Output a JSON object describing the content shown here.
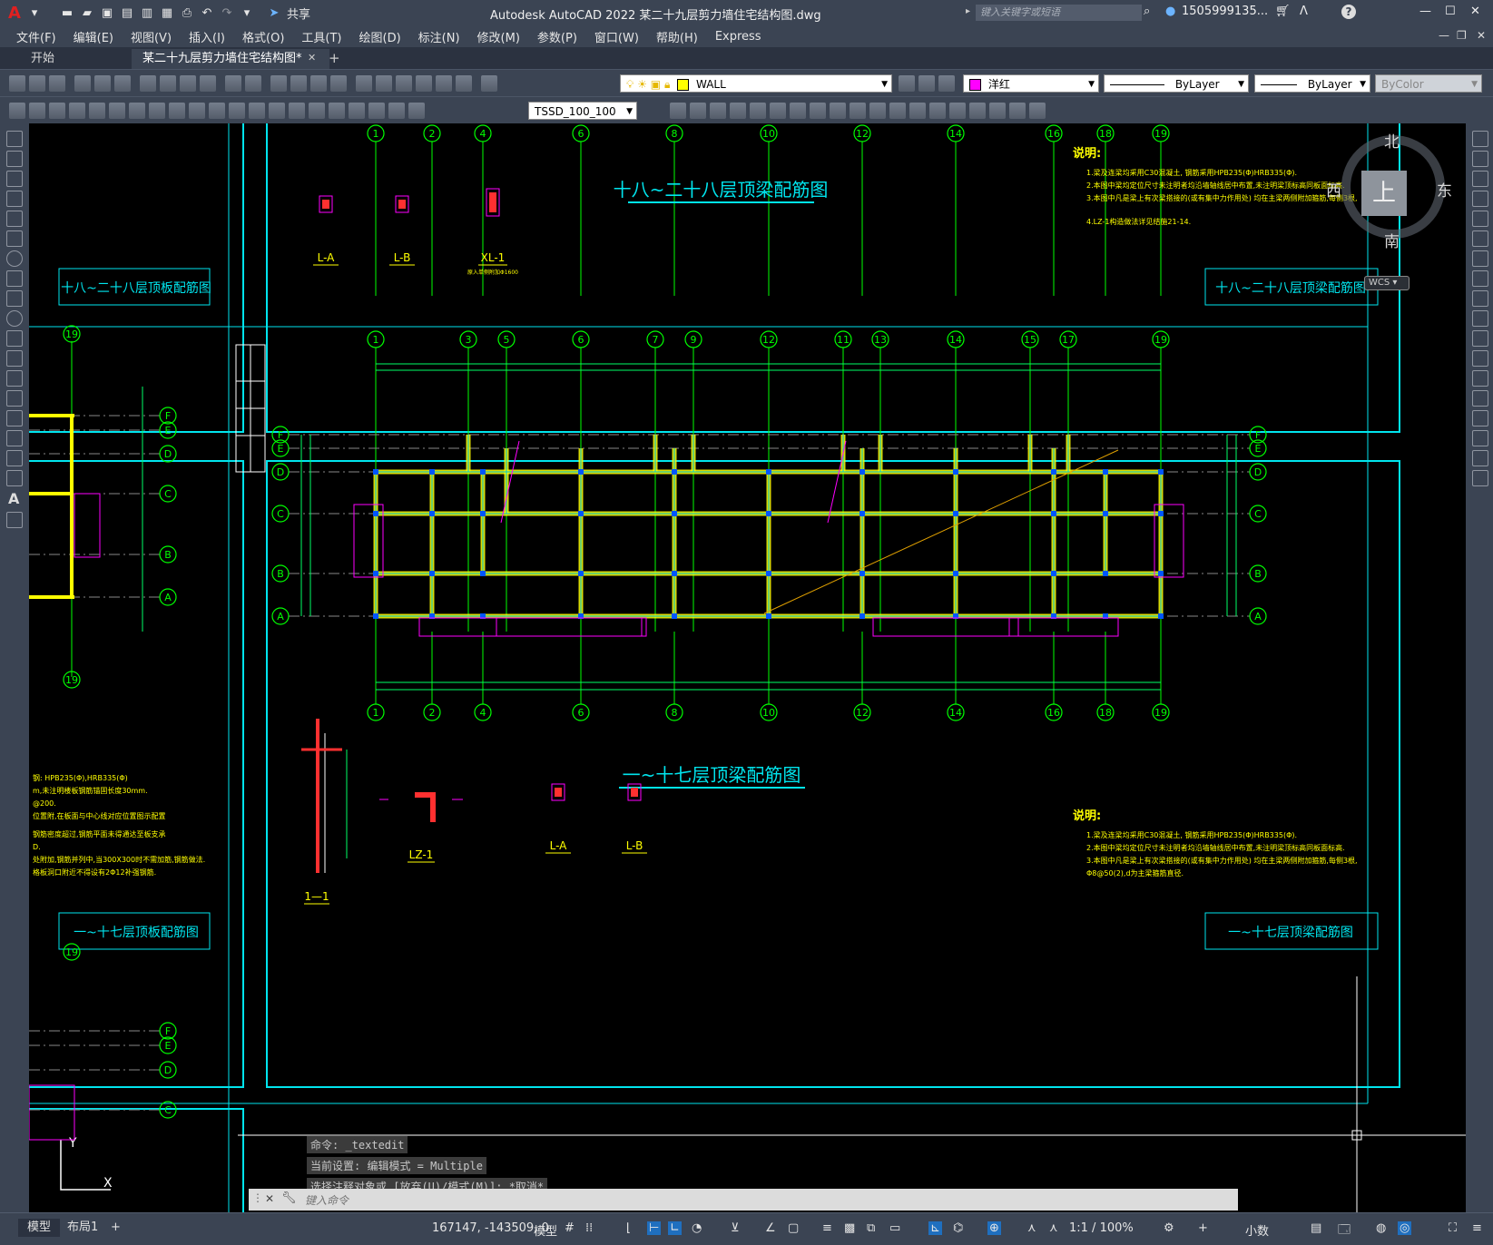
{
  "app": {
    "title": "Autodesk AutoCAD 2022    某二十九层剪力墙住宅结构图.dwg",
    "share_label": "共享",
    "search_placeholder": "键入关键字或短语",
    "user": "1505999135...",
    "logo_letter": "A"
  },
  "menu": [
    "文件(F)",
    "编辑(E)",
    "视图(V)",
    "插入(I)",
    "格式(O)",
    "工具(T)",
    "绘图(D)",
    "标注(N)",
    "修改(M)",
    "参数(P)",
    "窗口(W)",
    "帮助(H)",
    "Express"
  ],
  "tabs": [
    {
      "label": "开始"
    },
    {
      "label": "某二十九层剪力墙住宅结构图*"
    }
  ],
  "toolbar": {
    "layer": "WALL",
    "color": "洋红",
    "linetype": "ByLayer",
    "lineweight": "ByLayer",
    "plotstyle": "ByColor",
    "textstyle": "TSSD_100_100"
  },
  "colors": {
    "frame": "#00e5ee",
    "axis": "#00ff00",
    "wall": "#ffff00",
    "beam": "#ff00ff",
    "dim": "#00ff66",
    "bubble": "#00ff00",
    "text": "#ffff00",
    "column": "#0055ff"
  },
  "viewcube": {
    "north": "北",
    "south": "南",
    "east": "东",
    "west": "西",
    "top": "上",
    "wcs": "WCS"
  },
  "drawing": {
    "top_title": "十八~二十八层顶梁配筋图",
    "main_title": "一~十七层顶梁配筋图",
    "panel_tr": "十八~二十八层顶梁配筋图",
    "panel_tl": "十八~二十八层顶板配筋图",
    "panel_br": "一~十七层顶梁配筋图",
    "panel_bl": "一~十七层顶板配筋图",
    "notes_title": "说明:",
    "notes_top": [
      "1.梁及连梁均采用C30混凝土, 钢筋采用HPB235(Φ)HRB335(Φ).",
      "2.本图中梁均定位尺寸未注明者均沿墙轴线居中布置,未注明梁顶标高同板面标高.",
      "3.本图中凡是梁上有次梁搭接的(或有集中力作用处) 均在主梁两侧附加箍筋,每侧3根,",
      "4.LZ-1构造做法详见结施21-14."
    ],
    "notes_bottom": [
      "1.梁及连梁均采用C30混凝土, 钢筋采用HPB235(Φ)HRB335(Φ).",
      "2.本图中梁均定位尺寸未注明者均沿墙轴线居中布置,未注明梁顶标高同板面标高.",
      "3.本图中凡是梁上有次梁搭接的(或有集中力作用处) 均在主梁两侧附加箍筋,每侧3根,",
      "  Φ8@50(2),d为主梁箍筋直径."
    ],
    "left_notes": [
      "钢: HPB235(Φ),HRB335(Φ)",
      "m,未注明楼板钢筋锚固长度30mm.",
      "@200.",
      "位置附,在板面与中心线对应位置图示配置",
      "钢筋密度超过,钢筋平面未得通达至板支承",
      "D.",
      "处附加,钢筋并列中,当300X300时不需加筋,钢筋做法.",
      "格板洞口附近不得设有2Φ12补强钢筋."
    ],
    "top_axes": [
      "1",
      "2",
      "4",
      "6",
      "8",
      "10",
      "12",
      "14",
      "16",
      "18",
      "19"
    ],
    "main_axes_top": [
      "1",
      "3",
      "5",
      "6",
      "7",
      "9",
      "12",
      "11",
      "13",
      "14",
      "15",
      "17",
      "19"
    ],
    "main_axes_bottom": [
      "1",
      "2",
      "4",
      "6",
      "8",
      "10",
      "12",
      "14",
      "16",
      "18",
      "19"
    ],
    "row_axes": [
      "F",
      "E",
      "D",
      "C",
      "B",
      "A"
    ],
    "section_labels": {
      "la": "L-A",
      "lb": "L-B",
      "xl": "XL-1",
      "lz": "LZ-1",
      "sec": "1—1",
      "xl_note": "原入单侧附加Φ1600"
    },
    "left_axis_19": "19"
  },
  "command": {
    "history": [
      "命令: _textedit",
      "当前设置: 编辑模式 = Multiple",
      "选择注释对象或 [放弃(U)/模式(M)]: *取消*"
    ],
    "placeholder": "键入命令"
  },
  "status": {
    "tabs": [
      "模型",
      "布局1"
    ],
    "coords": "167147, -143509, 0",
    "model": "模型",
    "scale": "1:1 / 100%",
    "units": "小数"
  }
}
